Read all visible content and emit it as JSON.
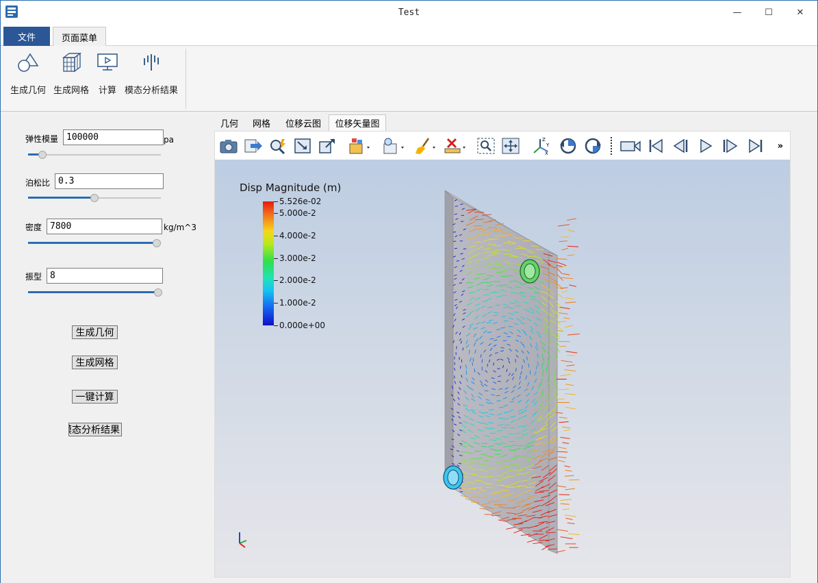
{
  "window": {
    "title": "Test",
    "minimize": "—",
    "maximize": "☐",
    "close": "✕"
  },
  "ribbon_tabs": {
    "file": "文件",
    "page_menu": "页面菜单"
  },
  "ribbon_buttons": [
    {
      "label": "生成几何",
      "icon": "geometry-icon"
    },
    {
      "label": "生成网格",
      "icon": "mesh-cube-icon"
    },
    {
      "label": "计算",
      "icon": "monitor-play-icon"
    },
    {
      "label": "模态分析结果",
      "icon": "modal-bars-icon"
    }
  ],
  "params": {
    "elastic_modulus": {
      "label": "弹性模量",
      "value": "100000",
      "unit": "pa",
      "slider": 0.08
    },
    "poisson": {
      "label": "泊松比",
      "value": "0.3",
      "slider": 0.5
    },
    "density": {
      "label": "密度",
      "value": "7800",
      "unit": "kg/m^3",
      "slider": 1.0
    },
    "mode": {
      "label": "振型",
      "value": "8",
      "slider": 1.0
    }
  },
  "actions": {
    "gen_geometry": "生成几何",
    "gen_mesh": "生成网格",
    "compute": "一键计算",
    "modal_result": "模态分析结果"
  },
  "view_tabs": [
    "几何",
    "网格",
    "位移云图",
    "位移矢量图"
  ],
  "active_view_tab": 3,
  "toolbar_more": "»",
  "legend": {
    "title": "Disp Magnitude (m)",
    "labels": [
      "5.526e-02",
      "5.000e-2",
      "4.000e-2",
      "3.000e-2",
      "2.000e-2",
      "1.000e-2",
      "0.000e+00"
    ],
    "values": [
      0.05526,
      0.05,
      0.04,
      0.03,
      0.02,
      0.01,
      0.0
    ],
    "max": 0.05526
  },
  "colors": {
    "accent": "#2b5797",
    "slider": "#2b6cb0"
  }
}
